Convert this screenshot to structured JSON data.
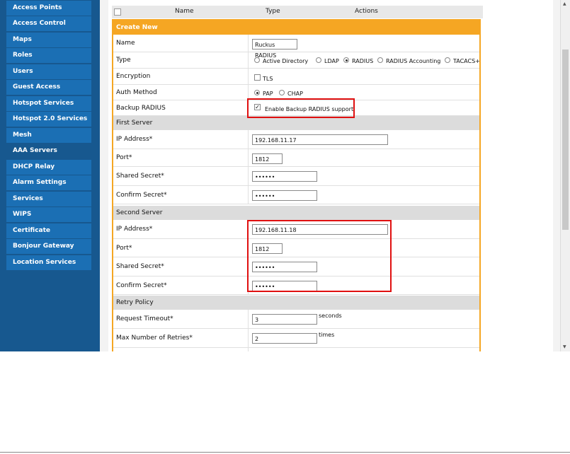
{
  "sidebar": {
    "items": [
      {
        "label": "Access Points",
        "active": false
      },
      {
        "label": "Access Control",
        "active": false
      },
      {
        "label": "Maps",
        "active": false
      },
      {
        "label": "Roles",
        "active": false
      },
      {
        "label": "Users",
        "active": false
      },
      {
        "label": "Guest Access",
        "active": false
      },
      {
        "label": "Hotspot Services",
        "active": false
      },
      {
        "label": "Hotspot 2.0 Services",
        "active": false
      },
      {
        "label": "Mesh",
        "active": false
      },
      {
        "label": "AAA Servers",
        "active": true
      },
      {
        "label": "DHCP Relay",
        "active": false
      },
      {
        "label": "Alarm Settings",
        "active": false
      },
      {
        "label": "Services",
        "active": false
      },
      {
        "label": "WIPS",
        "active": false
      },
      {
        "label": "Certificate",
        "active": false
      },
      {
        "label": "Bonjour Gateway",
        "active": false
      },
      {
        "label": "Location Services",
        "active": false
      }
    ]
  },
  "table_header": {
    "name": "Name",
    "type": "Type",
    "actions": "Actions"
  },
  "form": {
    "title": "Create New",
    "name_label": "Name",
    "name_value": "Ruckus RADIUS",
    "type_label": "Type",
    "type_options": [
      "Active Directory",
      "LDAP",
      "RADIUS",
      "RADIUS Accounting",
      "TACACS+"
    ],
    "type_selected": "RADIUS",
    "encryption_label": "Encryption",
    "encryption_option": "TLS",
    "auth_label": "Auth Method",
    "auth_options": [
      "PAP",
      "CHAP"
    ],
    "auth_selected": "PAP",
    "backup_label": "Backup RADIUS",
    "backup_option": "Enable Backup RADIUS support",
    "first_server": {
      "section": "First Server",
      "ip_label": "IP Address*",
      "ip_value": "192.168.11.17",
      "port_label": "Port*",
      "port_value": "1812",
      "secret_label": "Shared Secret*",
      "secret_value": "••••••",
      "confirm_label": "Confirm Secret*",
      "confirm_value": "••••••"
    },
    "second_server": {
      "section": "Second Server",
      "ip_label": "IP Address*",
      "ip_value": "192.168.11.18",
      "port_label": "Port*",
      "port_value": "1812",
      "secret_label": "Shared Secret*",
      "secret_value": "••••••",
      "confirm_label": "Confirm Secret*",
      "confirm_value": "••••••"
    },
    "retry": {
      "section": "Retry Policy",
      "timeout_label": "Request Timeout*",
      "timeout_value": "3",
      "timeout_unit": "seconds",
      "retries_label": "Max Number of Retries*",
      "retries_value": "2",
      "retries_unit": "times"
    }
  },
  "colors": {
    "sidebar_bg": "#17588f",
    "nav_item": "#1b6fb4",
    "form_header": "#f5a623",
    "highlight": "#e01010"
  }
}
